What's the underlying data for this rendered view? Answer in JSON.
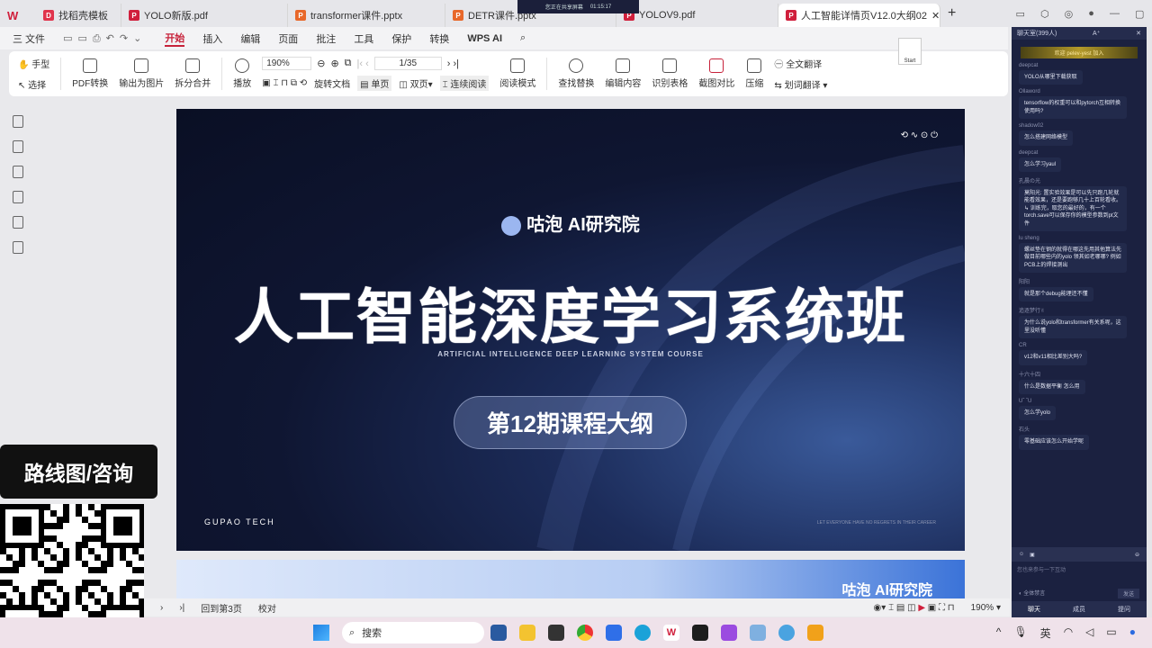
{
  "tabs": [
    {
      "label": "找稻壳模板",
      "color": "#e0344c"
    },
    {
      "label": "YOLO新版.pdf",
      "color": "#d01f3c"
    },
    {
      "label": "transformer课件.pptx",
      "color": "#e8682a"
    },
    {
      "label": "DETR课件.pptx",
      "color": "#e8682a"
    },
    {
      "label": "YOLOV9.pdf",
      "color": "#d01f3c"
    },
    {
      "label": "人工智能详情页V12.0大纲02",
      "color": "#d01f3c"
    }
  ],
  "share_banner": {
    "text": "您正在共享屏幕",
    "time": "01:15:17"
  },
  "menu": [
    "三 文件",
    "开始",
    "插入",
    "编辑",
    "页面",
    "批注",
    "工具",
    "保护",
    "转换",
    "WPS AI"
  ],
  "menu_active": "开始",
  "toolbar": {
    "hand": "手型",
    "select": "选择",
    "pdf_convert": "PDF转换",
    "export_image": "输出为图片",
    "split_merge": "拆分合并",
    "play": "播放",
    "zoom": "190%",
    "page": "1/35",
    "rotate": "旋转文档",
    "single": "单页",
    "double": "双页",
    "continuous": "连续阅读",
    "read_mode": "阅读模式",
    "find_replace": "查找替换",
    "edit_content": "编辑内容",
    "ocr_table": "识别表格",
    "screenshot_compare": "截图对比",
    "compress": "压缩",
    "full_translate": "全文翻译",
    "word_translate": "划词翻译"
  },
  "start_tooltip": "Start",
  "slide": {
    "brand": "咕泡 AI研究院",
    "title": "人工智能深度学习系统班",
    "subtitle": "ARTIFICIAL INTELLIGENCE DEEP LEARNING SYSTEM COURSE",
    "badge": "第12期课程大纲",
    "footer_left": "GUPAO TECH",
    "footer_right": "LET EVERYONE HAVE NO REGRETS IN THEIR CAREER"
  },
  "slide2_brand": "咕泡 AI研究院",
  "status": {
    "back": "回到第3页",
    "proof": "校对",
    "zoom": "190%"
  },
  "chat": {
    "title": "聊天室(399人)",
    "font": "A⁺",
    "welcome": "欢迎 pelev-yest 加入",
    "messages": [
      {
        "user": "deepcat",
        "text": "YOLO从哪里下载获取"
      },
      {
        "user": "Ollaword",
        "text": "tensorflow的权重可以和pytorch互相转换使用吗?"
      },
      {
        "user": "shadow02",
        "text": "怎么搭建网络模型"
      },
      {
        "user": "deepcat",
        "text": "怎么学习yaul"
      },
      {
        "user": "孔晨の光",
        "text": "莫阳光: 置实验效果是可以先只跑几轮就能看效果，还是要跑够几十上百轮看收。 ↳ 训练完，取您的最好的，有一个torch.save可以保存你的模型参数到pt文件"
      },
      {
        "user": "lu sheng",
        "text": "螺丝垫在钢的就得在哪这先用其他算法先做目前哪些内的yolo 领其如老哪哪? 例如PCB上的焊接测出"
      },
      {
        "user": "阳阳",
        "text": "就是那个debug能理还不懂"
      },
      {
        "user": "追逐梦行✌",
        "text": "为什么说yolo和transformer有关系呢，这里没听懂"
      },
      {
        "user": "CR",
        "text": "v12和v11相比差别大吗?"
      },
      {
        "user": "十六十四",
        "text": "什么是数据平衡 怎么用"
      },
      {
        "user": "Uˆ ˆU",
        "text": "怎么学yolo"
      },
      {
        "user": "石头",
        "text": "零基础应该怎么开始学呢"
      }
    ],
    "input_placeholder": "您也来参与一下互动",
    "mute_all": "全体禁言",
    "send": "发送",
    "tabs": [
      "聊天",
      "成员",
      "提问"
    ]
  },
  "qr_caption": "路线图/咨询",
  "taskbar": {
    "search": "搜索",
    "ime": "英"
  }
}
